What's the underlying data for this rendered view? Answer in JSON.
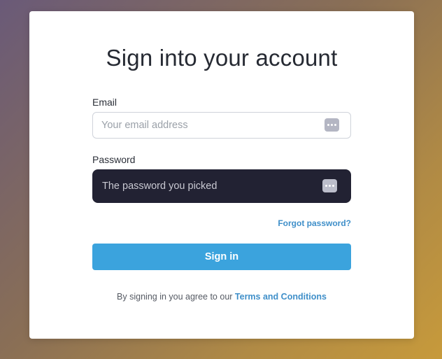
{
  "page": {
    "title": "Sign into your account"
  },
  "email": {
    "label": "Email",
    "placeholder": "Your email address",
    "value": ""
  },
  "password": {
    "label": "Password",
    "placeholder": "The password you picked",
    "value": ""
  },
  "links": {
    "forgot_password": "Forgot password?"
  },
  "actions": {
    "sign_in": "Sign in"
  },
  "terms": {
    "prefix": "By signing in you agree to our ",
    "link": "Terms and Conditions"
  },
  "icons": {
    "field_icon": "password-manager-icon"
  },
  "colors": {
    "accent": "#3ba3dd",
    "link": "#3f8fc9",
    "password_field_bg": "#222233"
  }
}
